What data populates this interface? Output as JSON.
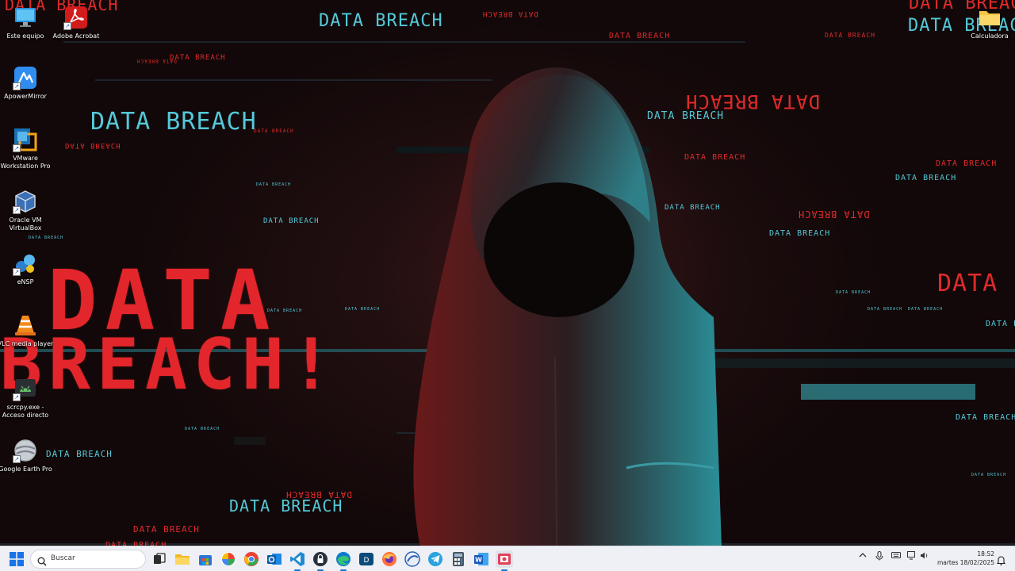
{
  "desktop": {
    "icons": [
      {
        "label": "Este equipo",
        "icon": "monitor-icon"
      },
      {
        "label": "Adobe Acrobat",
        "icon": "adobe-acrobat-icon"
      },
      {
        "label": "ApowerMirror",
        "icon": "apowermirror-icon"
      },
      {
        "label": "VMware Workstation Pro",
        "icon": "vmware-icon"
      },
      {
        "label": "Oracle VM VirtualBox",
        "icon": "virtualbox-icon"
      },
      {
        "label": "eNSP",
        "icon": "ensp-icon"
      },
      {
        "label": "VLC media player",
        "icon": "vlc-icon"
      },
      {
        "label": "scrcpy.exe - Acceso directo",
        "icon": "scrcpy-icon"
      },
      {
        "label": "Google Earth Pro",
        "icon": "google-earth-icon"
      },
      {
        "label": "Calculadora",
        "icon": "folder-icon"
      }
    ]
  },
  "wallpaper": {
    "phrase": "DATA BREACH",
    "word_data": "DATA",
    "word_breach": "BREACH!",
    "colors": {
      "red": "#e02a2a",
      "cyan": "#53c9d8"
    }
  },
  "taskbar": {
    "search_placeholder": "Buscar",
    "apps": [
      "windows-start-icon",
      "task-view-icon",
      "file-explorer-icon",
      "store-icon",
      "pinwheel-icon",
      "chrome-icon",
      "outlook-icon",
      "vscode-icon",
      "security-icon",
      "edge-icon",
      "dell-icon",
      "firefox-icon",
      "browser-icon",
      "telegram-icon",
      "calculator-icon",
      "word-icon",
      "snipping-icon"
    ],
    "clock": {
      "time": "18:52",
      "date": "martes 18/02/2025"
    }
  }
}
